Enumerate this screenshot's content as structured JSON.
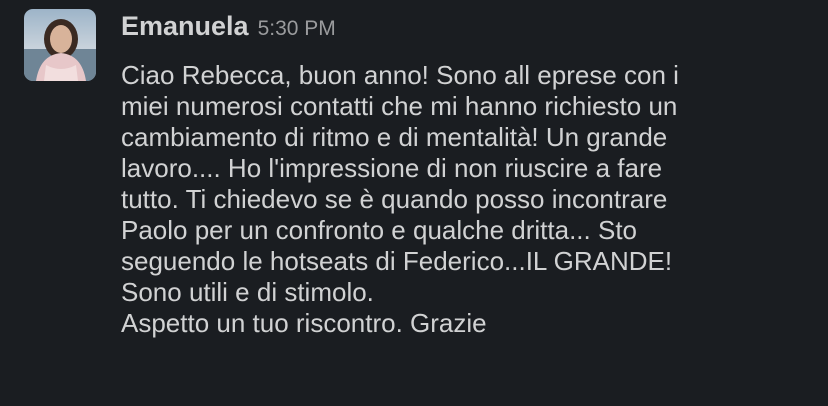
{
  "message": {
    "sender": "Emanuela",
    "timestamp": "5:30 PM",
    "avatar_icon": "profile-photo",
    "lines": [
      "Ciao Rebecca, buon anno! Sono all eprese con i",
      "miei numerosi contatti che mi hanno richiesto un",
      "cambiamento di ritmo e di mentalità! Un grande",
      "lavoro.... Ho l'impressione di non riuscire a fare",
      "tutto. Ti chiedevo se è quando posso incontrare",
      "Paolo per un confronto e qualche dritta... Sto",
      "seguendo le hotseats di Federico...IL GRANDE!",
      "Sono utili e di stimolo.",
      "Aspetto un tuo riscontro. Grazie"
    ]
  },
  "colors": {
    "background": "#1a1d21",
    "text": "#d1d2d3",
    "timestamp": "#9a9b9d"
  }
}
